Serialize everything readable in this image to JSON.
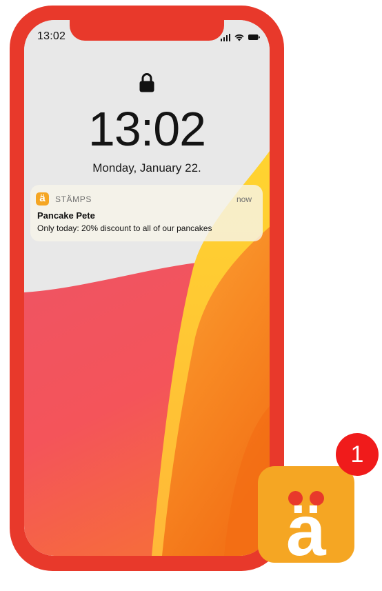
{
  "status_bar": {
    "time": "13:02",
    "signal_icon": "cellular-signal-icon",
    "wifi_icon": "wifi-icon",
    "battery_icon": "battery-icon"
  },
  "lock_screen": {
    "lock_icon": "lock-icon",
    "clock": "13:02",
    "date": "Monday, January 22."
  },
  "notification": {
    "app_icon_letter": "ä",
    "app_name": "STÄMPS",
    "time": "now",
    "title": "Pancake Pete",
    "body": "Only today: 20% discount to all of our pancakes"
  },
  "app_icon": {
    "letter": "ä",
    "badge_count": "1"
  },
  "colors": {
    "phone_frame": "#e8392b",
    "app_orange": "#f5a623",
    "badge_red": "#f01b1b",
    "wallpaper_pink": "#ee4c5a",
    "wallpaper_orange": "#f47a1e",
    "wallpaper_yellow": "#ffd236"
  }
}
